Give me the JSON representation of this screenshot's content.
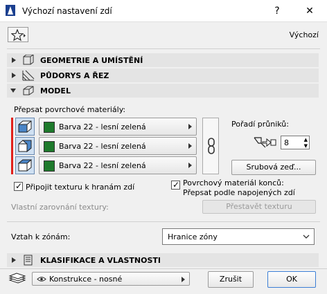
{
  "window": {
    "title": "Výchozí nastavení zdí",
    "help_label": "?",
    "close_label": "✕"
  },
  "header": {
    "defaults_label": "Výchozí"
  },
  "sections": {
    "geometry": "GEOMETRIE A UMÍSTĚNÍ",
    "floorplan": "PŮDORYS A ŘEZ",
    "model": "MODEL",
    "classification": "KLASIFIKACE A VLASTNOSTI"
  },
  "model": {
    "override_label": "Přepsat povrchové materiály:",
    "materials": [
      {
        "name": "Barva 22 - lesní zelená",
        "color": "#1e7a2c"
      },
      {
        "name": "Barva 22 - lesní zelená",
        "color": "#1e7a2c"
      },
      {
        "name": "Barva 22 - lesní zelená",
        "color": "#1e7a2c"
      }
    ],
    "intersection_order_label": "Pořadí průniků:",
    "intersection_order_value": "8",
    "log_wall_button": "Srubová zeď...",
    "attach_texture_label": "Připojit texturu k hranám zdí",
    "attach_texture_checked": true,
    "end_material_label_1": "Povrchový materiál konců:",
    "end_material_label_2": "Přepsat podle napojených zdí",
    "end_material_checked": true,
    "custom_texture_label": "Vlastní zarovnání textury:",
    "reset_texture_button": "Přestavět texturu",
    "zone_relation_label": "Vztah k zónám:",
    "zone_relation_value": "Hranice zóny"
  },
  "footer": {
    "layer_value": "Konstrukce - nosné",
    "cancel_label": "Zrušit",
    "ok_label": "OK"
  },
  "colors": {
    "accent_red": "#e0201b",
    "material_green": "#1e7a2c"
  }
}
